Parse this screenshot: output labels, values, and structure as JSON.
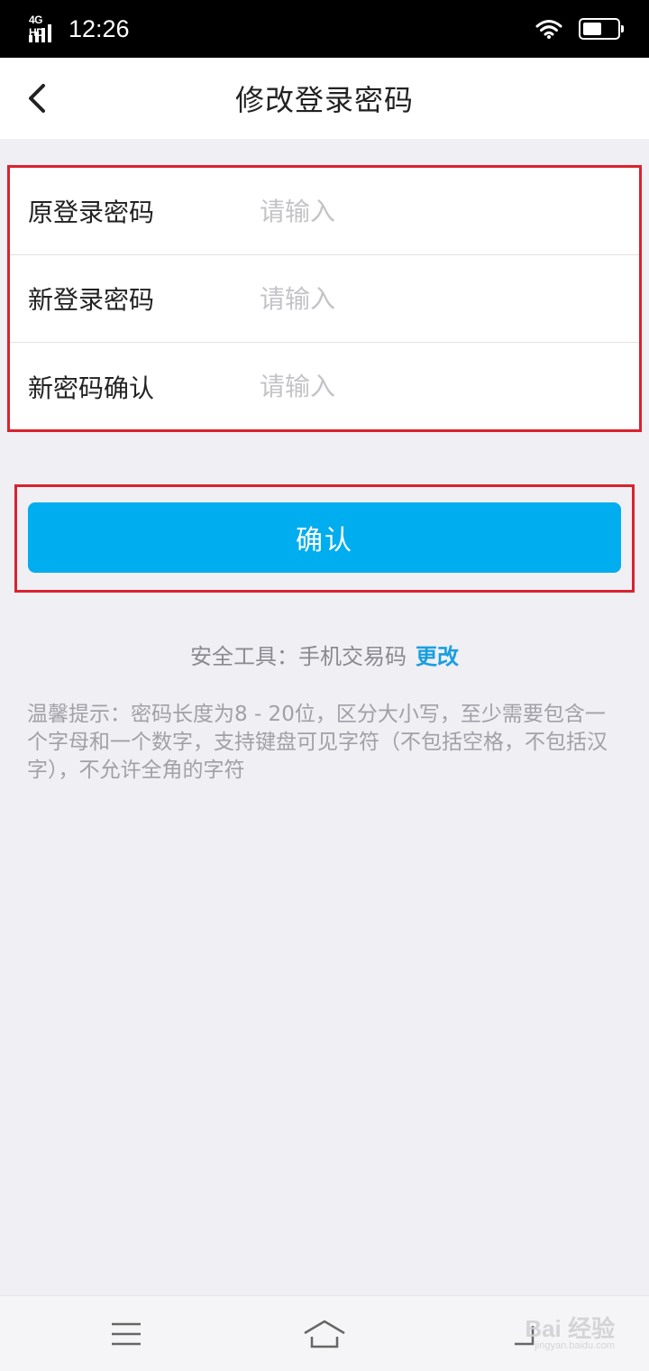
{
  "status_bar": {
    "network": "4G HD",
    "time": "12:26",
    "battery_level": 0.55,
    "wifi_icon": "wifi-icon",
    "battery_icon": "battery-icon"
  },
  "nav": {
    "title": "修改登录密码",
    "back_icon": "chevron-left-icon"
  },
  "form": {
    "rows": [
      {
        "label": "原登录密码",
        "value": "",
        "placeholder": "请输入"
      },
      {
        "label": "新登录密码",
        "value": "",
        "placeholder": "请输入"
      },
      {
        "label": "新密码确认",
        "value": "",
        "placeholder": "请输入"
      }
    ]
  },
  "confirm": {
    "label": "确认"
  },
  "security": {
    "prefix": "安全工具：手机交易码",
    "link": "更改"
  },
  "tips": {
    "text": "温馨提示：密码长度为8 - 20位，区分大小写，至少需要包含一个字母和一个数字，支持键盘可见字符（不包括空格，不包括汉字），不允许全角的字符"
  },
  "system_nav": {
    "icons": [
      "menu-icon",
      "home-icon",
      "back-icon"
    ]
  },
  "watermark": {
    "brand": "Bai 经验",
    "url": "jingyan.baidu.com"
  },
  "colors": {
    "accent": "#00adee",
    "link": "#1a9fe0",
    "highlight_border": "#d9232e",
    "background": "#efeff4"
  }
}
